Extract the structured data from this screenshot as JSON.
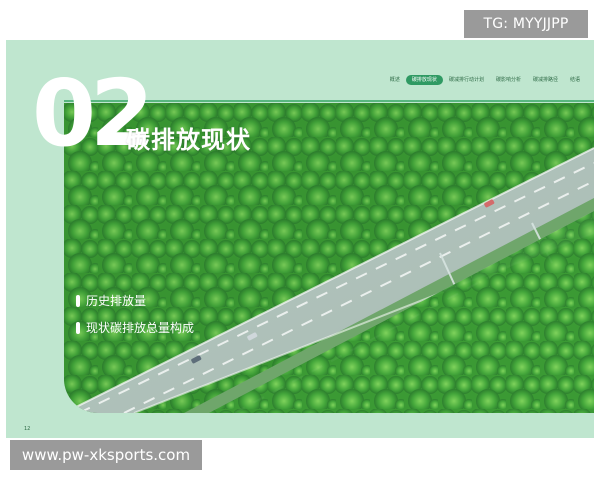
{
  "watermark_top": "TG: MYYJJPP",
  "watermark_bottom": "www.pw-xksports.com",
  "slide": {
    "section_number": "02",
    "section_title": "碳排放现状",
    "nav": [
      {
        "label": "概述",
        "active": false
      },
      {
        "label": "碳排放现状",
        "active": true
      },
      {
        "label": "碳减排行动计划",
        "active": false
      },
      {
        "label": "碳影响分析",
        "active": false
      },
      {
        "label": "碳减排路径",
        "active": false
      },
      {
        "label": "结语",
        "active": false
      }
    ],
    "bullets": [
      "历史排放量",
      "现状碳排放总量构成"
    ],
    "page_number": "12"
  },
  "colors": {
    "slide_background": "#bfe6cf",
    "accent_green": "#2f9a63",
    "white": "#ffffff"
  }
}
